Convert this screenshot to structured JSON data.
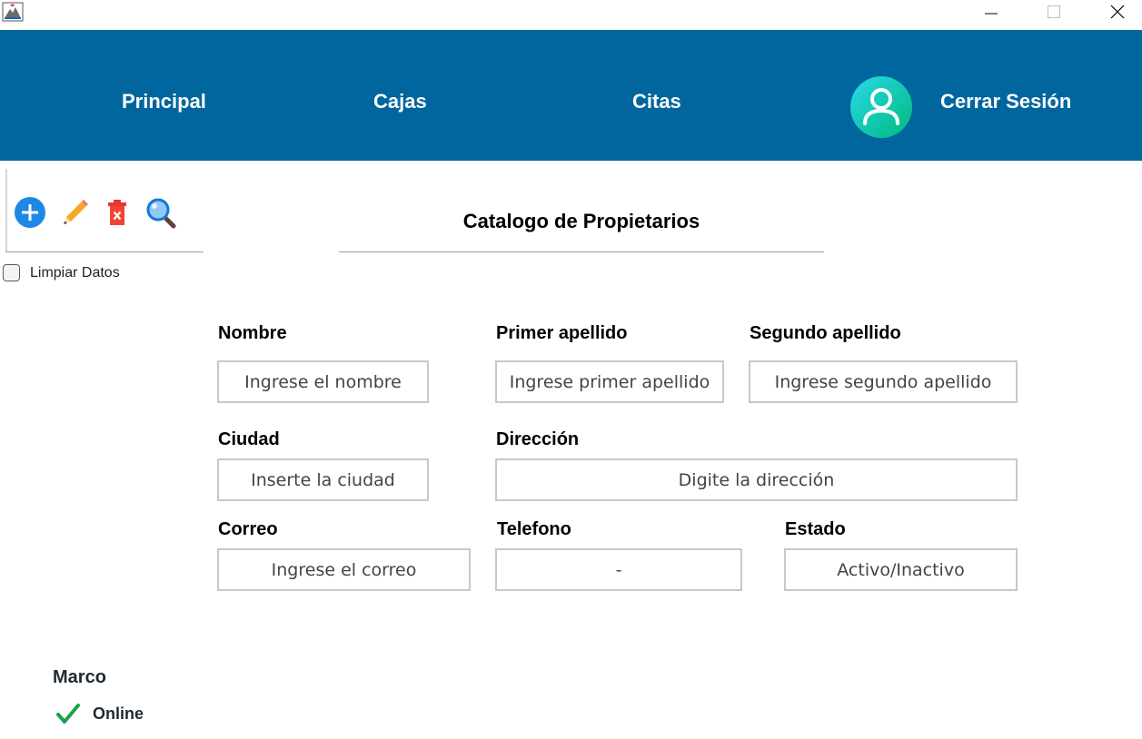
{
  "nav": {
    "principal": "Principal",
    "cajas": "Cajas",
    "citas": "Citas",
    "logout": "Cerrar Sesión"
  },
  "toolbar": {
    "icons": [
      "add-icon",
      "edit-pencil-icon",
      "delete-trash-icon",
      "search-magnifier-icon"
    ],
    "clear_label": "Limpiar Datos"
  },
  "form": {
    "title": "Catalogo de Propietarios",
    "fields": {
      "nombre": {
        "label": "Nombre",
        "placeholder": "Ingrese el nombre"
      },
      "primer_apellido": {
        "label": "Primer apellido",
        "placeholder": "Ingrese primer apellido"
      },
      "segundo_apellido": {
        "label": "Segundo apellido",
        "placeholder": "Ingrese segundo apellido"
      },
      "ciudad": {
        "label": "Ciudad",
        "placeholder": "Inserte la ciudad"
      },
      "direccion": {
        "label": "Dirección",
        "placeholder": "Digite la dirección"
      },
      "correo": {
        "label": "Correo",
        "placeholder": "Ingrese el correo"
      },
      "telefono": {
        "label": "Telefono",
        "placeholder": "-"
      },
      "estado": {
        "label": "Estado",
        "placeholder": "Activo/Inactivo"
      }
    }
  },
  "user": {
    "name": "Marco",
    "status": "Online"
  },
  "colors": {
    "navbar": "#00669d",
    "add_button": "#1e88e5",
    "delete_button": "#f44336",
    "online_check": "#1aa34a"
  }
}
